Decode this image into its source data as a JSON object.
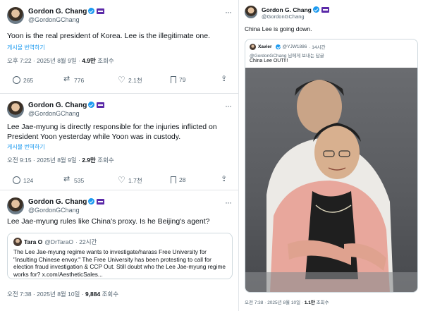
{
  "tweets": [
    {
      "author": "Gordon G. Chang",
      "handle": "@GordonGChang",
      "text": "Yoon is the real president of Korea. Lee is the illegitimate one.",
      "translate": "게시물 번역하기",
      "time": "오후 7:22 · 2025년 8월 9일 · ",
      "views": "4.9만",
      "views_label": " 조회수",
      "replies": "265",
      "retweets": "776",
      "likes": "2.1천",
      "bookmarks": "79"
    },
    {
      "author": "Gordon G. Chang",
      "handle": "@GordonGChang",
      "text": "Lee Jae-myung is directly responsible for the injuries inflicted on President Yoon yesterday while Yoon was in custody.",
      "translate": "게시물 번역하기",
      "time": "오전 9:15 · 2025년 8월 9일 · ",
      "views": "2.9만",
      "views_label": " 조회수",
      "replies": "124",
      "retweets": "535",
      "likes": "1.7천",
      "bookmarks": "28"
    },
    {
      "author": "Gordon G. Chang",
      "handle": "@GordonGChang",
      "text": "Lee Jae-myung rules like China's proxy. Is he Beijing's agent?",
      "time": "오전 7:38 · 2025년 8월 10일 · ",
      "views": "9,884",
      "views_label": " 조회수",
      "quote": {
        "author": "Tara O",
        "handle": "@DrTaraO",
        "age": "· 22시간",
        "text": "The Lee Jae-myung regime wants to investigate/harass Free University for \"insulting Chinese envoy.\" The Free University has been protesting to call for election fraud investigation & CCP Out. Still doubt who the Lee Jae-myung regime works for? x.com/AestheticSales..."
      }
    }
  ],
  "right": {
    "author": "Gordon G. Chang",
    "handle": "@GordonGChang",
    "text": "China Lee is going down.",
    "quote": {
      "author": "Xavier",
      "handle": "@YJW1886",
      "age": "· 14시간",
      "reply_to": "@GordonGChang 님에게 보내는 답글",
      "text": "China Lee OUT!!!"
    },
    "time": "오전 7:38 · 2025년 8월 10일 · ",
    "views": "1.1만",
    "views_label": " 조회수"
  }
}
